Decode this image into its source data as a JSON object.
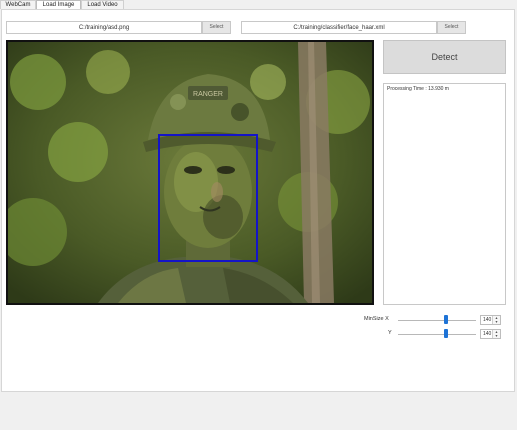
{
  "tabs": [
    "WebCam",
    "Load Image",
    "Load Video"
  ],
  "active_tab": "Load Image",
  "image_path": "C:/training/asd.png",
  "classifier_path": "C:/training/classifier/face_haar.xml",
  "select_label": "Select",
  "detect_label": "Detect",
  "log_text": "Processing Time : 13.930 m",
  "minsize": {
    "x_label": "MinSize X",
    "y_label": "Y",
    "x_value": "140",
    "y_value": "140",
    "x_level": 0.62,
    "y_level": 0.62
  },
  "colors": {
    "detection_box": "#1414c8",
    "slider_thumb": "#1e73d6"
  },
  "icons": [
    "spin-up-icon",
    "spin-down-icon"
  ]
}
